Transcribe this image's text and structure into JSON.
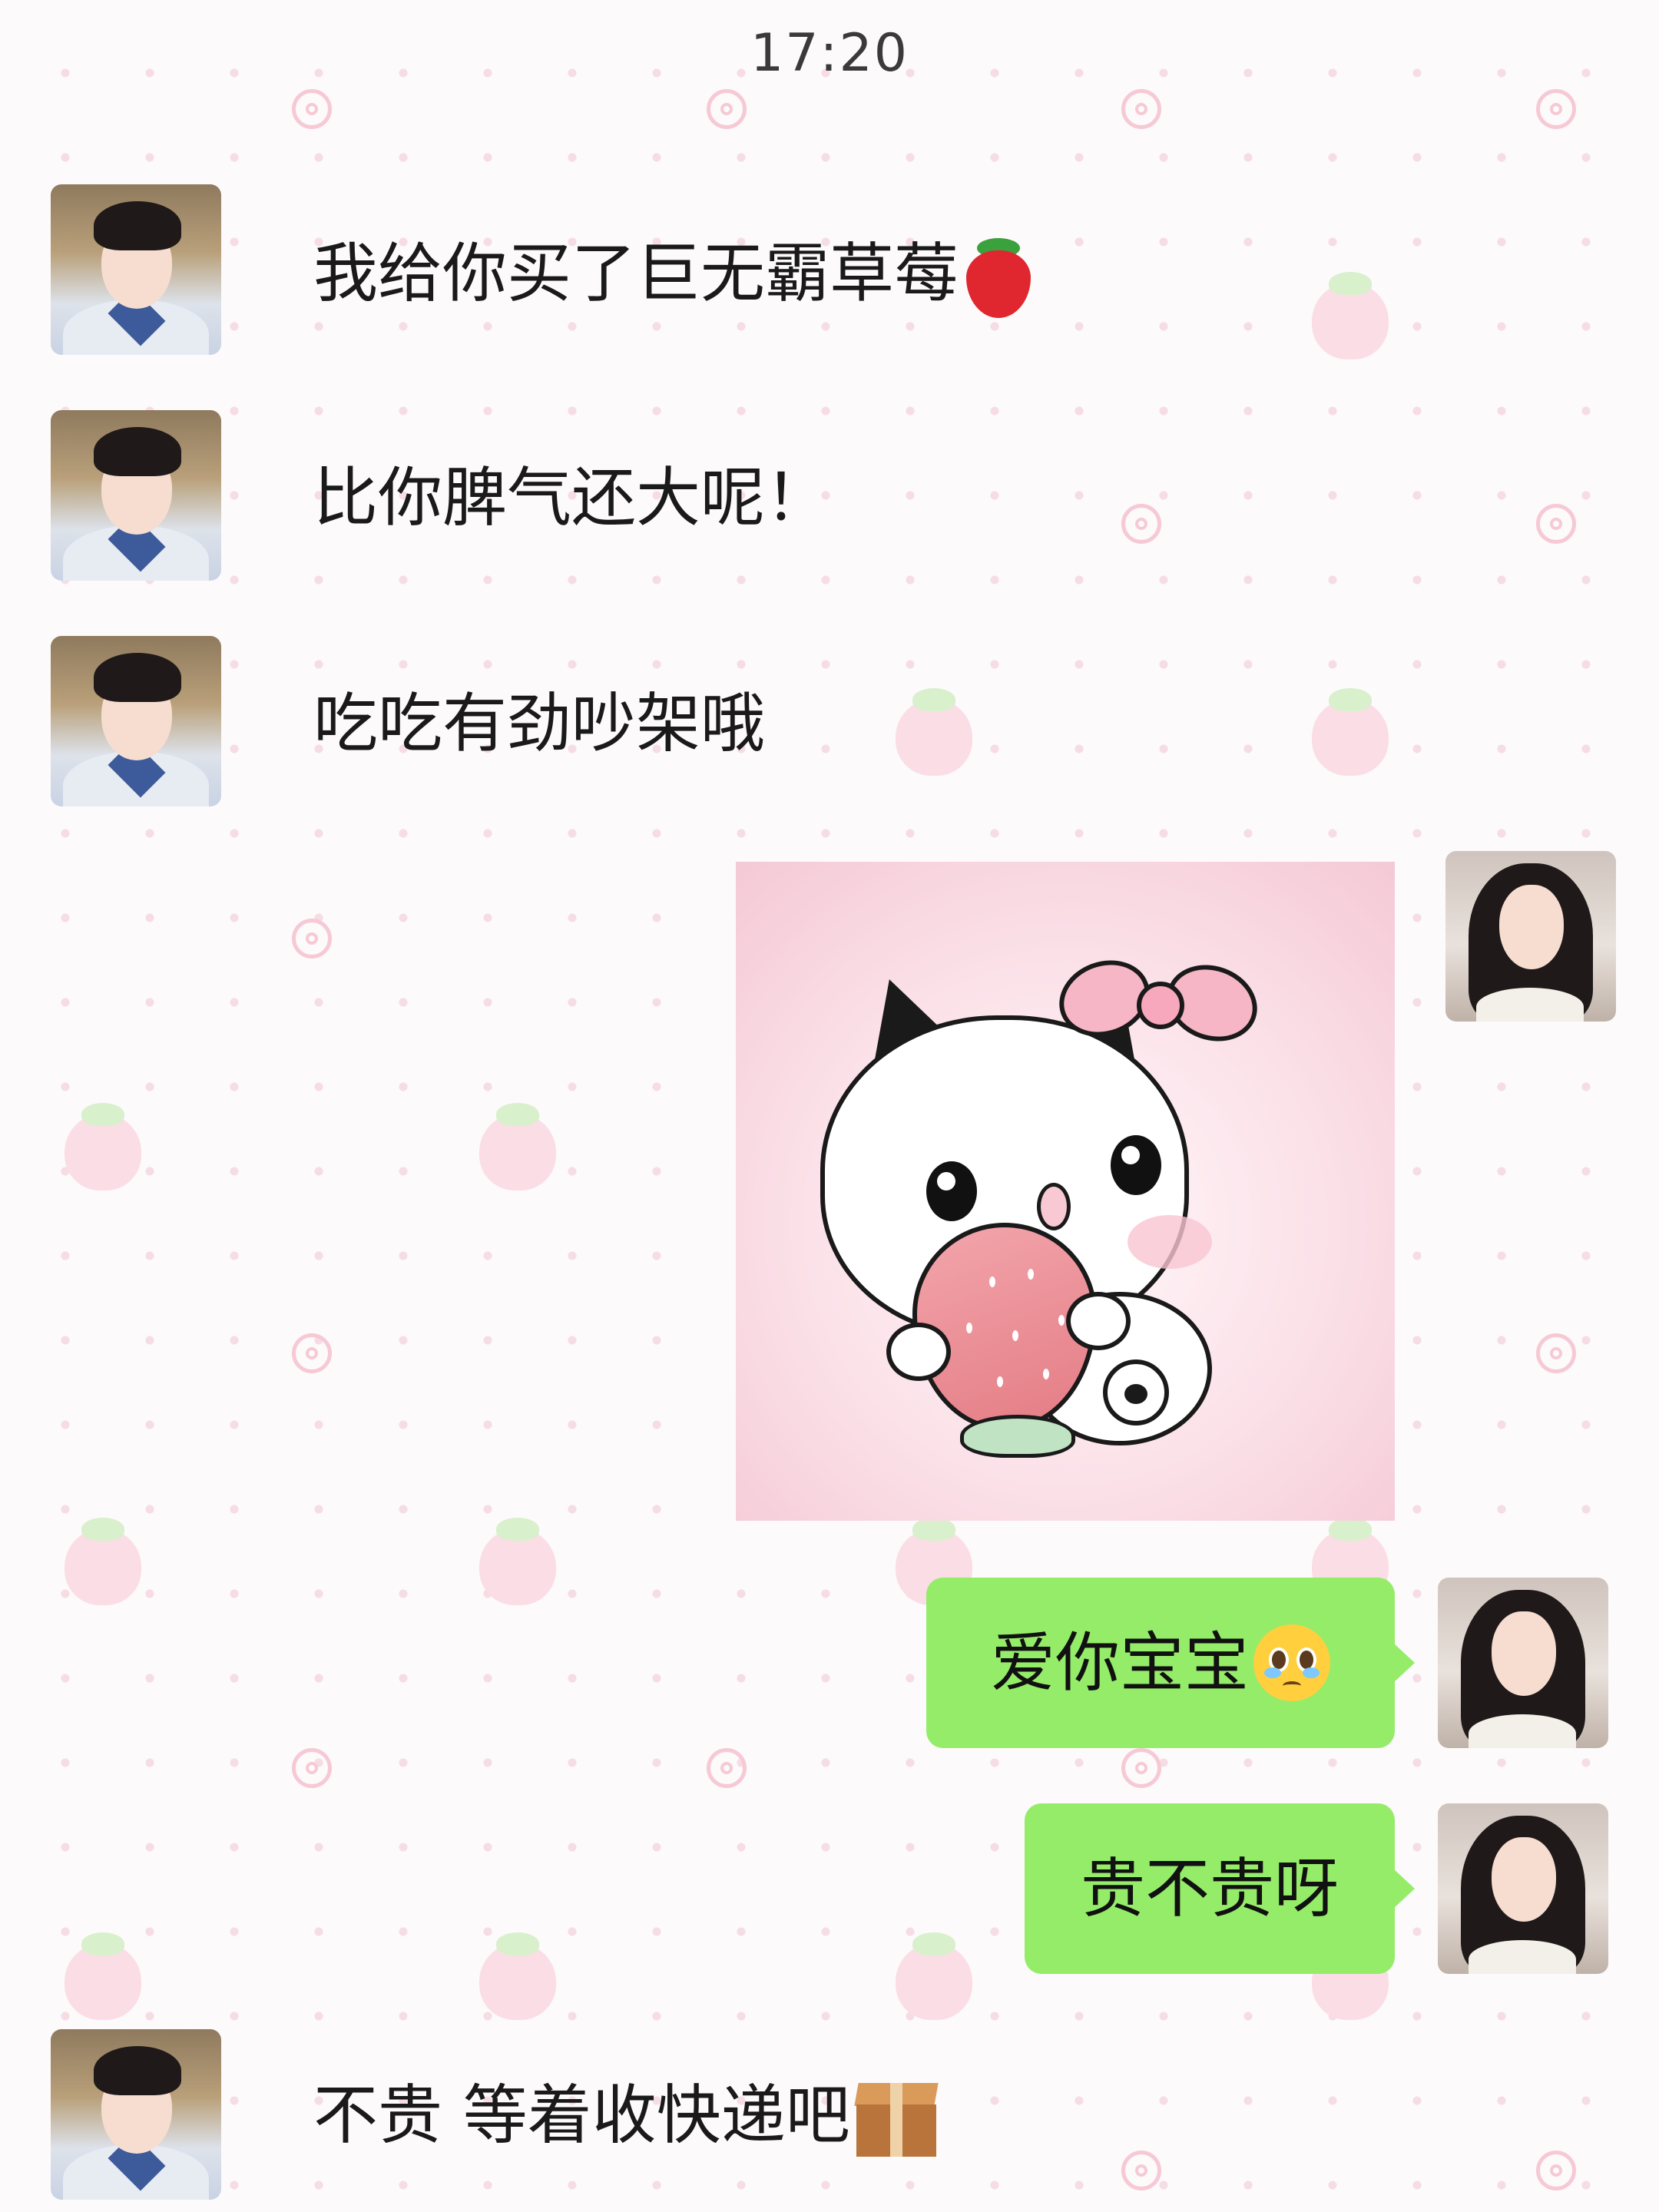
{
  "status_bar": {
    "time": "17:20"
  },
  "messages": [
    {
      "sender": "contact",
      "text": "我给你买了巨无霸草莓",
      "emoji": "strawberry-emoji"
    },
    {
      "sender": "contact",
      "text": "比你脾气还大呢！"
    },
    {
      "sender": "contact",
      "text": "吃吃有劲吵架哦"
    },
    {
      "sender": "me",
      "type": "sticker",
      "sticker": "pink-bow-kitten-holding-strawberry"
    },
    {
      "sender": "me",
      "text": "爱你宝宝",
      "emoji": "pleading-face-emoji"
    },
    {
      "sender": "me",
      "text": "贵不贵呀"
    },
    {
      "sender": "contact",
      "text": "不贵 等着收快递吧",
      "emoji": "package-emoji"
    }
  ],
  "colors": {
    "my_bubble": "#95ec69",
    "background": "#fcfafb",
    "background_pattern": "#fbdde6",
    "text": "#1a1a1a"
  }
}
